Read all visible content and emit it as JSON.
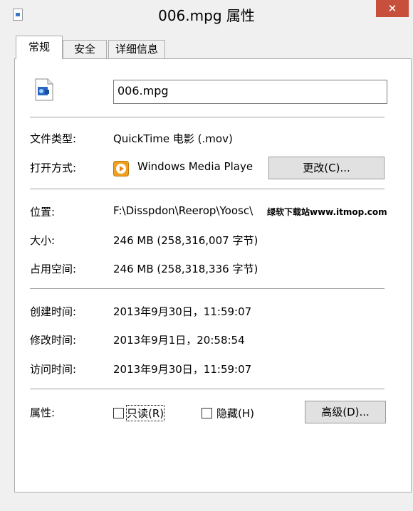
{
  "window": {
    "title": "006.mpg 属性",
    "close_label": "✕"
  },
  "tabs": [
    {
      "label": "常规",
      "active": true
    },
    {
      "label": "安全",
      "active": false
    },
    {
      "label": "详细信息",
      "active": false
    }
  ],
  "general": {
    "file_name": "006.mpg",
    "file_type_label": "文件类型:",
    "file_type_value": "QuickTime 电影 (.mov)",
    "open_with_label": "打开方式:",
    "open_with_value": "Windows Media Playe",
    "change_button": "更改(C)...",
    "location_label": "位置:",
    "location_value": "F:\\Disspdon\\Reerop\\Yoosc\\",
    "size_label": "大小:",
    "size_value": "246 MB (258,316,007 字节)",
    "size_on_disk_label": "占用空间:",
    "size_on_disk_value": "246 MB (258,318,336 字节)",
    "created_label": "创建时间:",
    "created_value": "2013年9月30日，11:59:07",
    "modified_label": "修改时间:",
    "modified_value": "2013年9月1日，20:58:54",
    "accessed_label": "访问时间:",
    "accessed_value": "2013年9月30日，11:59:07",
    "attributes_label": "属性:",
    "readonly_label": "只读(R)",
    "readonly_checked": false,
    "hidden_label": "隐藏(H)",
    "hidden_checked": false,
    "advanced_button": "高级(D)..."
  },
  "watermark": "绿软下载站www.itmop.com",
  "colors": {
    "close_button": "#c7503c",
    "panel_bg": "#ffffff",
    "window_bg": "#f0f0f0"
  }
}
